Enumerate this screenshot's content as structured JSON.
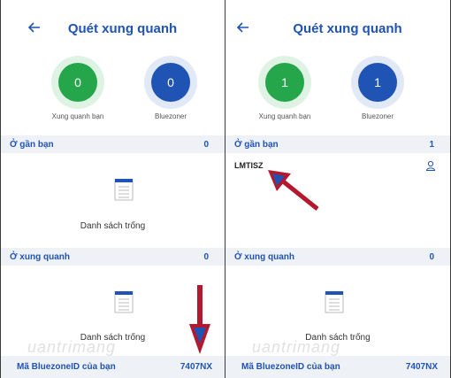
{
  "left": {
    "title": "Quét xung quanh",
    "nearby_count": "0",
    "bluezoner_count": "0",
    "nearby_label": "Xung quanh bạn",
    "bluezoner_label": "Bluezoner",
    "near_section": {
      "label": "Ở gần bạn",
      "count": "0"
    },
    "near_empty": "Danh sách trống",
    "around_section": {
      "label": "Ở xung quanh",
      "count": "0"
    },
    "around_empty": "Danh sách trống",
    "footer": {
      "label": "Mã BluezoneID của bạn",
      "id": "7407NX"
    }
  },
  "right": {
    "title": "Quét xung quanh",
    "nearby_count": "1",
    "bluezoner_count": "1",
    "nearby_label": "Xung quanh bạn",
    "bluezoner_label": "Bluezoner",
    "near_section": {
      "label": "Ở gần bạn",
      "count": "1"
    },
    "device_id": "LMTISZ",
    "around_section": {
      "label": "Ở xung quanh",
      "count": "0"
    },
    "around_empty": "Danh sách trống",
    "footer": {
      "label": "Mã BluezoneID của bạn",
      "id": "7407NX"
    }
  },
  "colors": {
    "accent": "#1f53b4",
    "green": "#26a64a",
    "arrow": "#b3182f"
  },
  "watermark": "uantrimang"
}
